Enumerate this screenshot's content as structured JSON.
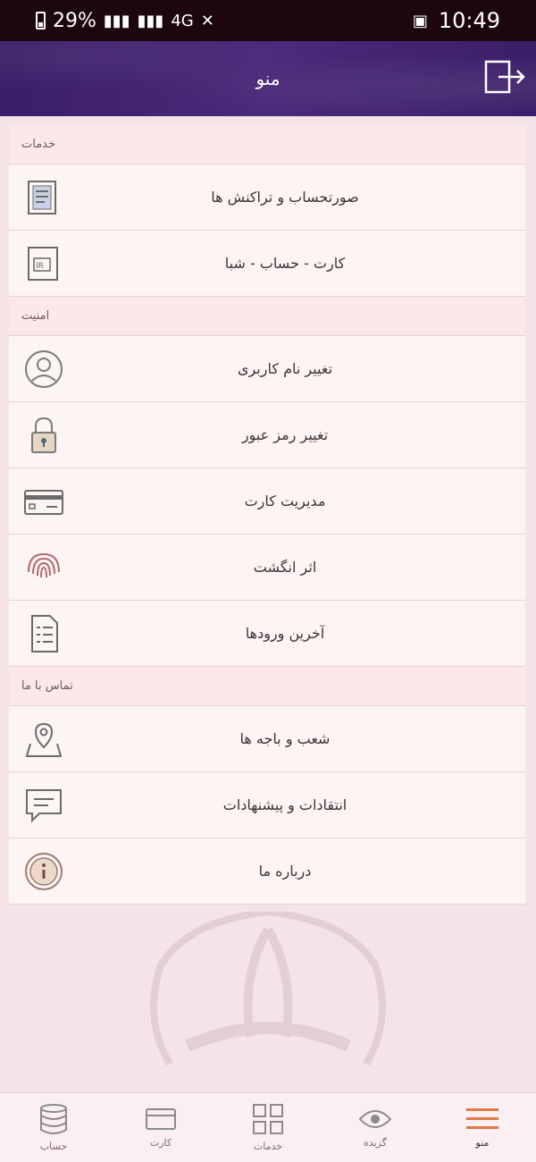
{
  "status_bar": {
    "battery_percent": "29%",
    "signal": "4G",
    "time": "10:49"
  },
  "header": {
    "title": "منو",
    "exit_icon": "exit-icon"
  },
  "sections": [
    {
      "title": "خدمات",
      "items": [
        {
          "label": "صورتحساب و تراکنش ها",
          "icon": "statement-icon"
        },
        {
          "label": "کارت - حساب - شبا",
          "icon": "iban-card-icon"
        }
      ]
    },
    {
      "title": "امنیت",
      "items": [
        {
          "label": "تغییر نام کاربری",
          "icon": "user-icon"
        },
        {
          "label": "تغییر رمز عبور",
          "icon": "lock-icon"
        },
        {
          "label": "مدیریت کارت",
          "icon": "card-icon"
        },
        {
          "label": "اثر انگشت",
          "icon": "fingerprint-icon"
        },
        {
          "label": "آخرین ورودها",
          "icon": "document-list-icon"
        }
      ]
    },
    {
      "title": "تماس با ما",
      "items": [
        {
          "label": "شعب و باجه ها",
          "icon": "location-icon"
        },
        {
          "label": "انتقادات و پیشنهادات",
          "icon": "feedback-icon"
        },
        {
          "label": "درباره ما",
          "icon": "info-icon"
        }
      ]
    }
  ],
  "bottom_nav": [
    {
      "label": "حساب",
      "icon": "coins-icon"
    },
    {
      "label": "کارت",
      "icon": "card-icon"
    },
    {
      "label": "خدمات",
      "icon": "grid-icon"
    },
    {
      "label": "گزیده",
      "icon": "eye-icon"
    },
    {
      "label": "منو",
      "icon": "menu-icon",
      "active": true
    }
  ],
  "colors": {
    "header_purple": "#3b1e68",
    "page_bg": "#f4e4e7",
    "accent_orange": "#e07a46"
  }
}
